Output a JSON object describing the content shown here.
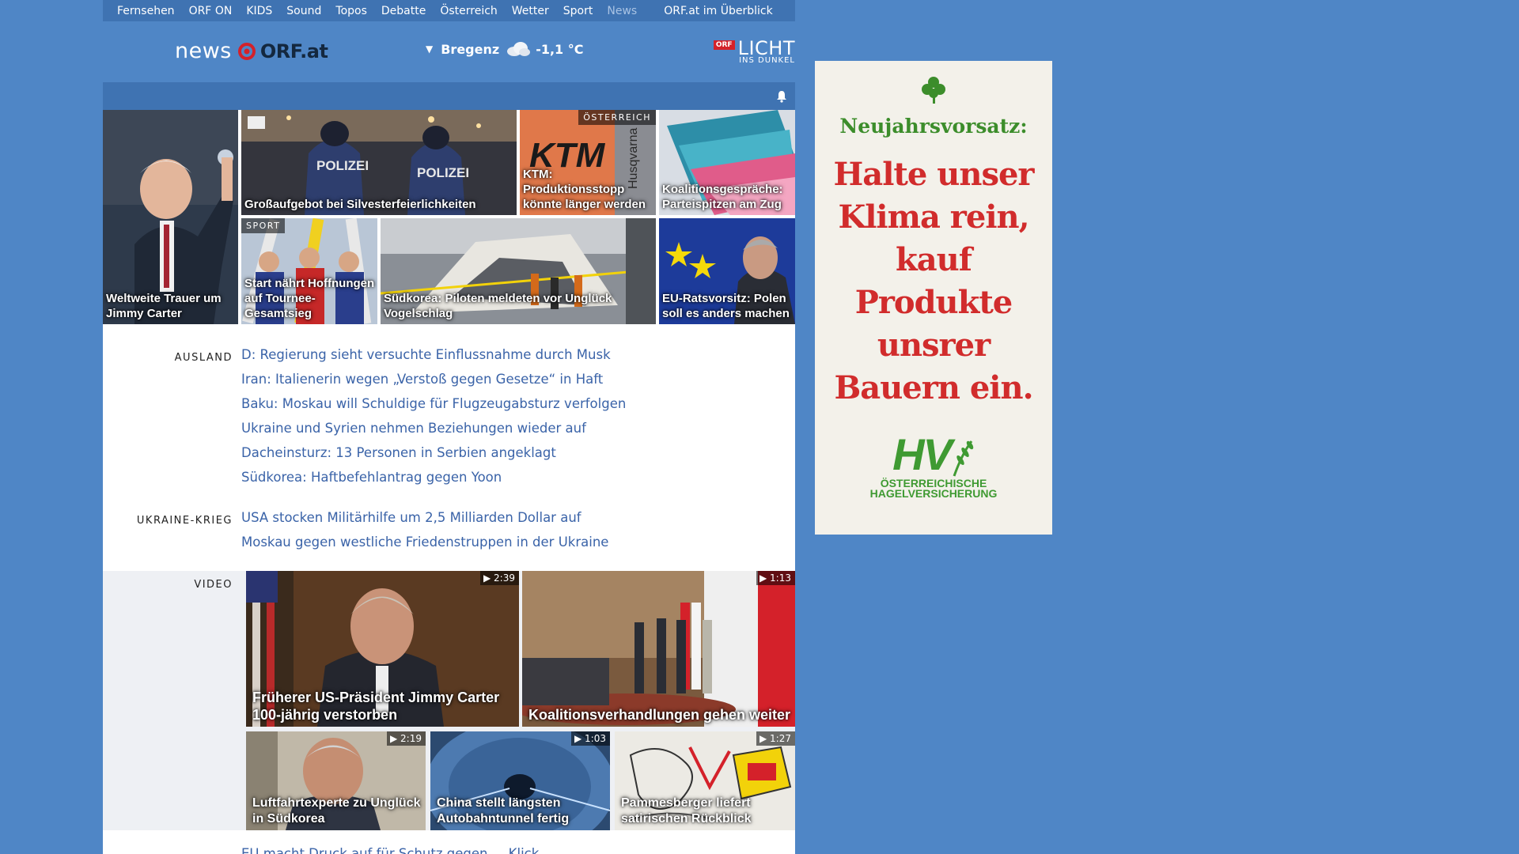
{
  "nav": {
    "items": [
      "Fernsehen",
      "ORF ON",
      "KIDS",
      "Sound",
      "Topos",
      "Debatte",
      "Österreich",
      "Wetter",
      "Sport",
      "News"
    ],
    "overview": "ORF.at im Überblick"
  },
  "header": {
    "logo_news": "news",
    "logo_orf": "ORF.at",
    "weather_city": "Bregenz",
    "weather_temp": "-1,1 °C",
    "licht_badge": "ORF",
    "licht_word": "LICHT",
    "licht_sub": "INS DUNKEL"
  },
  "tiles": {
    "carter": "Weltweite Trauer um Jimmy Carter",
    "polizei": "Großaufgebot bei Silvesterfeierlichkeiten",
    "ktm_tag": "ÖSTERREICH",
    "ktm": "KTM: Produktionsstopp könnte länger werden",
    "koalition": "Koalitionsgespräche: Parteispitzen am Zug",
    "sport_tag": "SPORT",
    "skisprung": "Start nährt Hoffnungen auf Tournee-Gesamtsieg",
    "suedkorea": "Südkorea: Piloten meldeten vor Unglück Vogelschlag",
    "eu": "EU-Ratsvorsitz: Polen soll es anders machen"
  },
  "ausland": {
    "label": "AUSLAND",
    "items": [
      "D: Regierung sieht versuchte Einflussnahme durch Musk",
      "Iran: Italienerin wegen „Verstoß gegen Gesetze“ in Haft",
      "Baku: Moskau will Schuldige für Flugzeugabsturz verfolgen",
      "Ukraine und Syrien nehmen Beziehungen wieder auf",
      "Dacheinsturz: 13 Personen in Serbien angeklagt",
      "Südkorea: Haftbefehlantrag gegen Yoon"
    ]
  },
  "ukraine": {
    "label": "UKRAINE-KRIEG",
    "items": [
      "USA stocken Militärhilfe um 2,5 Milliarden Dollar auf",
      "Moskau gegen westliche Friedenstruppen in der Ukraine"
    ]
  },
  "video": {
    "label": "VIDEO",
    "items": [
      {
        "title": "Früherer US-Präsident Jimmy Carter 100-jährig verstorben",
        "duration": "2:39"
      },
      {
        "title": "Koalitionsverhandlungen gehen weiter",
        "duration": "1:13"
      },
      {
        "title": "Luftfahrtexperte zu Unglück in Südkorea",
        "duration": "2:19"
      },
      {
        "title": "China stellt längsten Autobahntunnel fertig",
        "duration": "1:03"
      },
      {
        "title": "Pammesberger liefert satirischen Rückblick",
        "duration": "1:27"
      }
    ]
  },
  "partial_next": "EU macht Druck auf für Schutz gegen ... Klick",
  "ad": {
    "headline": "Neujahrsvorsatz:",
    "body": "Halte unser Klima rein, kauf Produkte unsrer Bauern ein.",
    "brand": "HV",
    "brand_sub_1": "ÖSTERREICHISCHE",
    "brand_sub_2": "HAGELVERSICHERUNG"
  },
  "colors": {
    "page_bg": "#4f86c6",
    "nav_bg": "#3f73b2",
    "link": "#3a63a8",
    "orf_red": "#d4212a",
    "ad_green": "#3c8d2b",
    "ad_red": "#d12c2c"
  }
}
